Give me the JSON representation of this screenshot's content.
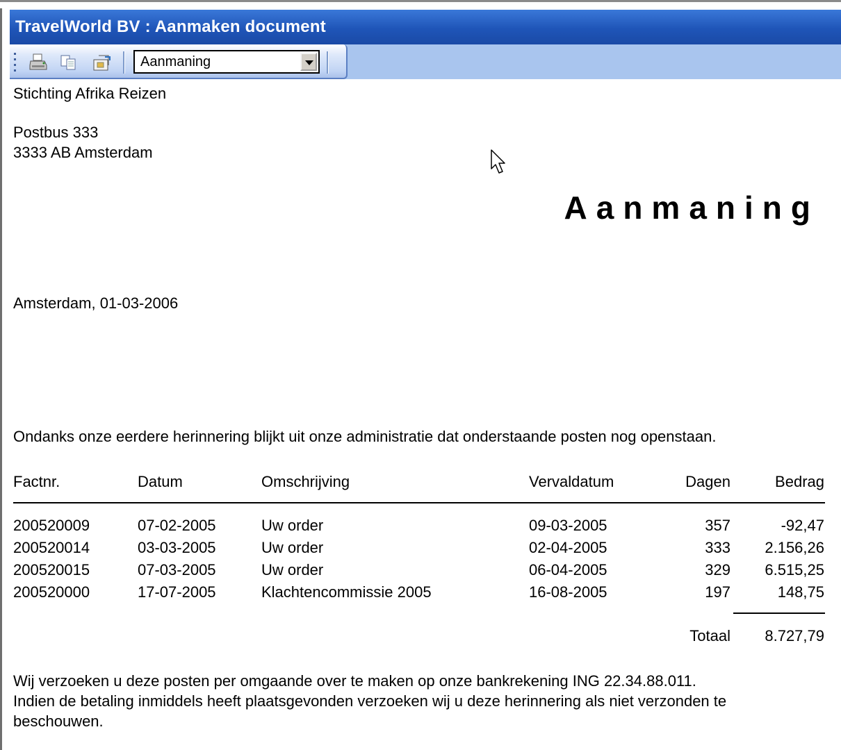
{
  "window": {
    "title": "TravelWorld BV : Aanmaken document"
  },
  "toolbar": {
    "buttons": [
      {
        "icon": "print-icon"
      },
      {
        "icon": "copy-icon"
      },
      {
        "icon": "export-icon"
      }
    ],
    "doc_type_select": "Aanmaning"
  },
  "letter": {
    "recipient": {
      "name": "Stichting Afrika Reizen",
      "address_line1": "Postbus 333",
      "address_line2": "3333 AB  Amsterdam"
    },
    "heading": "Aanmaning",
    "place_date": "Amsterdam, 01-03-2006",
    "intro": "Ondanks onze eerdere herinnering blijkt uit onze administratie dat onderstaande posten nog openstaan.",
    "table": {
      "headers": [
        "Factnr.",
        "Datum",
        "Omschrijving",
        "Vervaldatum",
        "Dagen",
        "Bedrag"
      ],
      "rows": [
        [
          "200520009",
          "07-02-2005",
          "Uw order",
          "09-03-2005",
          "357",
          "-92,47"
        ],
        [
          "200520014",
          "03-03-2005",
          "Uw order",
          "02-04-2005",
          "333",
          "2.156,26"
        ],
        [
          "200520015",
          "07-03-2005",
          "Uw order",
          "06-04-2005",
          "329",
          "6.515,25"
        ],
        [
          "200520000",
          "17-07-2005",
          "Klachtencommissie 2005",
          "16-08-2005",
          "197",
          "148,75"
        ]
      ],
      "total_label": "Totaal",
      "total_value": "8.727,79"
    },
    "closing_line1": "Wij verzoeken u deze posten per omgaande over te maken op onze bankrekening ING 22.34.88.011.",
    "closing_line2": "Indien de betaling inmiddels heeft plaatsgevonden verzoeken wij u deze herinnering als niet verzonden te",
    "closing_line3": "beschouwen."
  }
}
